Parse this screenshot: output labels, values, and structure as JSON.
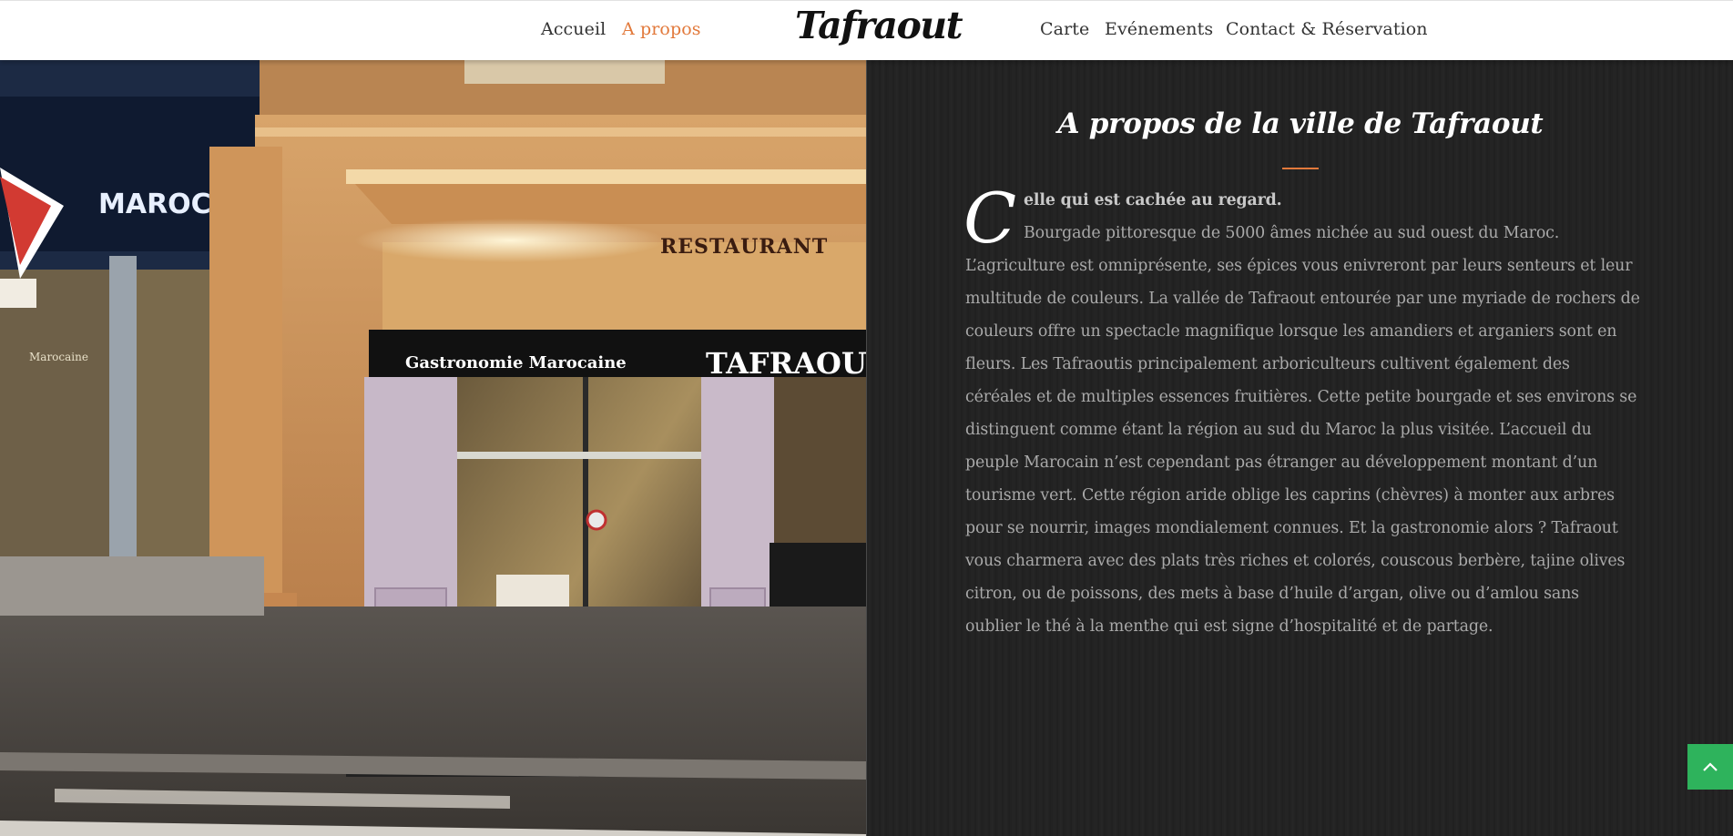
{
  "nav": {
    "brand": "Tafraout",
    "left_items": [
      {
        "label": "Accueil",
        "active": false
      },
      {
        "label": "A propos",
        "active": true
      }
    ],
    "right_items": [
      {
        "label": "Carte",
        "active": false
      },
      {
        "label": "Evénements",
        "active": false
      },
      {
        "label": "Contact & Réservation",
        "active": false
      }
    ]
  },
  "photo": {
    "signs": {
      "marocain": "MAROCAIN",
      "restaurant": "RESTAURANT",
      "gastronomie": "Gastronomie Marocaine",
      "tafraout": "TAFRAOUT",
      "window": "Marocaine"
    }
  },
  "about": {
    "title": "A propos de la ville de Tafraout",
    "dropcap": "C",
    "lead": "elle qui est cachée au regard.",
    "lines": [
      "Bourgade pittoresque de 5000 âmes nichée au sud ouest du Maroc.",
      "L’agriculture est omniprésente, ses épices vous enivreront par leurs senteurs et leur",
      "multitude de couleurs. La vallée de Tafraout entourée par une myriade de rochers de",
      "couleurs offre un spectacle magnifique lorsque les amandiers et arganiers sont en",
      "fleurs. Les Tafraoutis principalement arboriculteurs cultivent également des",
      "céréales et de multiples essences fruitières. Cette petite bourgade et ses environs se",
      "distinguent comme étant la région au sud du Maroc la plus visitée. L’accueil du",
      "peuple Marocain n’est cependant pas étranger au développement montant d’un",
      "tourisme vert. Cette région aride oblige les caprins (chèvres) à monter aux arbres",
      "pour se nourrir, images mondialement connues. Et la gastronomie alors ? Tafraout",
      "vous charmera avec des plats très riches et colorés, couscous berbère, tajine olives",
      "citron, ou de poissons, des mets à base d’huile d’argan, olive ou d’amlou sans",
      "oublier le thé à la menthe qui est signe d’hospitalité et de partage."
    ]
  },
  "colors": {
    "accent": "#e2793b",
    "back_to_top": "#2eb35c",
    "panel": "#232323"
  },
  "back_to_top": {
    "icon": "chevron-up-icon"
  }
}
